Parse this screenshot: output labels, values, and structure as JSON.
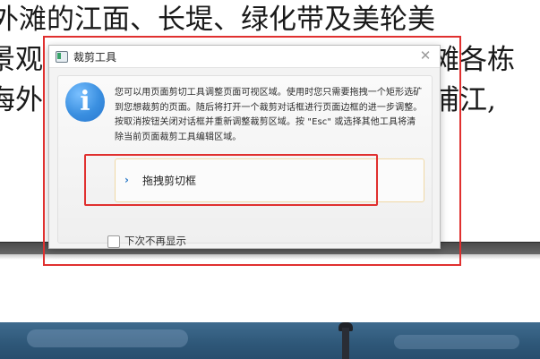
{
  "background_document": {
    "lines": [
      "外滩的江面、长堤、绿化带及美轮美",
      "景观　　　　　　　　　　　　　外滩各栋",
      "海外　　　　　　　　　　　　　黄浦江,"
    ]
  },
  "dialog": {
    "title": "裁剪工具",
    "close_glyph": "✕",
    "info_glyph": "i",
    "message": "您可以用页面剪切工具调整页面可视区域。使用时您只需要拖拽一个矩形选矿到您想裁剪的页面。随后将打开一个裁剪对话框进行页面边框的进一步调整。按取消按钮关闭对话框并重新调整裁剪区域。按 \"Esc\" 或选择其他工具将清除当前页面裁剪工具编辑区域。",
    "action_label": "拖拽剪切框",
    "action_glyph": "›",
    "checkbox_label": "下次不再显示",
    "checkbox_checked": false
  },
  "colors": {
    "annotation_red": "#e0302f",
    "info_blue": "#3a8fe0",
    "action_border": "#f0d9a6"
  }
}
